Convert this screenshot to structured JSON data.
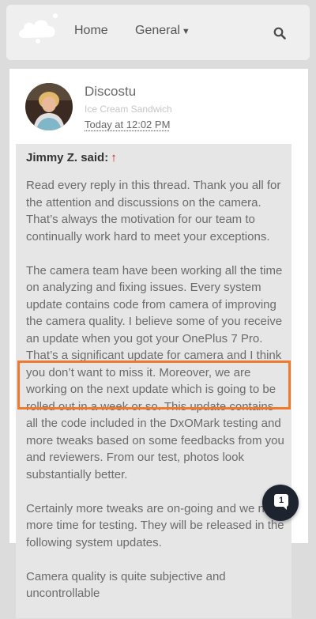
{
  "nav": {
    "home_label": "Home",
    "general_label": "General",
    "logo_icon": "cloud-logo-icon",
    "dropdown_icon": "caret-down-icon",
    "search_icon": "search-icon"
  },
  "post": {
    "username": "Discostu",
    "user_title": "Ice Cream Sandwich",
    "time": "Today at 12:02 PM"
  },
  "quote": {
    "author_said": "Jimmy Z. said:",
    "jump_icon": "↑",
    "paragraphs": [
      "Read every reply in this thread. Thank you all for the attention and discussions on the camera. That’s always the motivation for our team to continually work hard to meet your exceptions.",
      "The camera team have been working all the time on analyzing and fixing issues. Every system update contains code from camera of improving the camera quality. I believe some of you receive an update when you got your OnePlus 7 Pro. That’s a significant update for camera and I think you don’t want to miss it. Moreover, we are working on the next update which is going to be rolled out in a week or so. This update contains all the code included in the DxOMark testing and more tweaks based on some feedbacks from you and reviewers. From our test, photos look substantially better.",
      "Certainly more tweaks are on-going and we need more time for testing. They will be released in the following system updates.",
      "Camera quality is quite subjective and uncontrollable"
    ]
  },
  "notifications": {
    "count": "1",
    "icon": "chat-bubble-icon"
  },
  "colors": {
    "highlight_border": "#ee7a2e",
    "jump_arrow": "#d0121b",
    "notif_bg": "#1e2330"
  }
}
